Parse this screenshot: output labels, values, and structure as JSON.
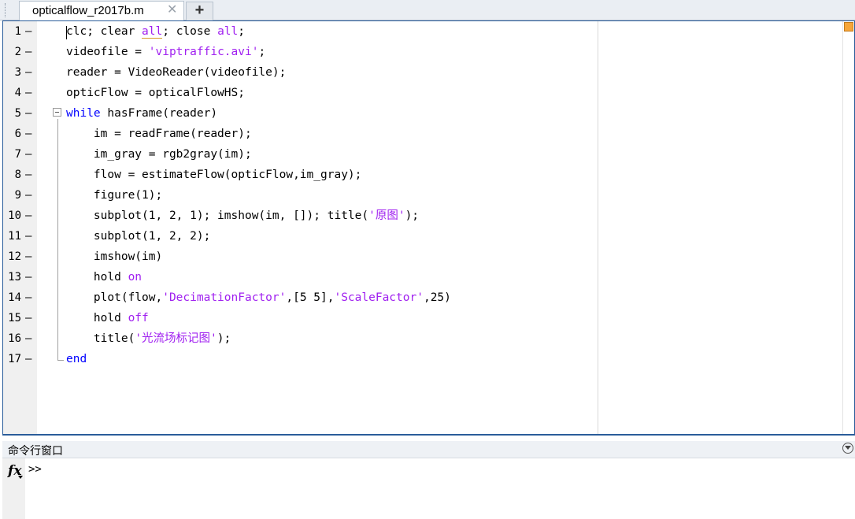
{
  "tabs": {
    "active_file": "opticalflow_r2017b.m",
    "close_glyph": "✕",
    "add_glyph": "+"
  },
  "editor": {
    "lines": [
      {
        "num": "1",
        "tokens": [
          {
            "t": "clc; clear "
          },
          {
            "t": "all",
            "c": "str",
            "u": true
          },
          {
            "t": "; close "
          },
          {
            "t": "all",
            "c": "str"
          },
          {
            "t": ";"
          }
        ]
      },
      {
        "num": "2",
        "tokens": [
          {
            "t": "videofile = "
          },
          {
            "t": "'viptraffic.avi'",
            "c": "str"
          },
          {
            "t": ";"
          }
        ]
      },
      {
        "num": "3",
        "tokens": [
          {
            "t": "reader = VideoReader(videofile);"
          }
        ]
      },
      {
        "num": "4",
        "tokens": [
          {
            "t": "opticFlow = opticalFlowHS;"
          }
        ]
      },
      {
        "num": "5",
        "tokens": [
          {
            "t": "while",
            "c": "kw"
          },
          {
            "t": " hasFrame(reader)"
          }
        ]
      },
      {
        "num": "6",
        "tokens": [
          {
            "t": "    im = readFrame(reader);"
          }
        ]
      },
      {
        "num": "7",
        "tokens": [
          {
            "t": "    im_gray = rgb2gray(im);"
          }
        ]
      },
      {
        "num": "8",
        "tokens": [
          {
            "t": "    flow = estimateFlow(opticFlow,im_gray);"
          }
        ]
      },
      {
        "num": "9",
        "tokens": [
          {
            "t": "    figure(1);"
          }
        ]
      },
      {
        "num": "10",
        "tokens": [
          {
            "t": "    subplot(1, 2, 1); imshow(im, []); title("
          },
          {
            "t": "'原图'",
            "c": "str"
          },
          {
            "t": ");"
          }
        ]
      },
      {
        "num": "11",
        "tokens": [
          {
            "t": "    subplot(1, 2, 2);"
          }
        ]
      },
      {
        "num": "12",
        "tokens": [
          {
            "t": "    imshow(im)"
          }
        ]
      },
      {
        "num": "13",
        "tokens": [
          {
            "t": "    hold "
          },
          {
            "t": "on",
            "c": "str"
          }
        ]
      },
      {
        "num": "14",
        "tokens": [
          {
            "t": "    plot(flow,"
          },
          {
            "t": "'DecimationFactor'",
            "c": "str"
          },
          {
            "t": ",[5 5],"
          },
          {
            "t": "'ScaleFactor'",
            "c": "str"
          },
          {
            "t": ",25)"
          }
        ]
      },
      {
        "num": "15",
        "tokens": [
          {
            "t": "    hold "
          },
          {
            "t": "off",
            "c": "str"
          }
        ]
      },
      {
        "num": "16",
        "tokens": [
          {
            "t": "    title("
          },
          {
            "t": "'光流场标记图'",
            "c": "str"
          },
          {
            "t": ");"
          }
        ]
      },
      {
        "num": "17",
        "tokens": [
          {
            "t": "end",
            "c": "kw"
          }
        ]
      }
    ],
    "line_marker": "—",
    "colors": {
      "keyword": "#0000ff",
      "string": "#a020f0"
    }
  },
  "command_window": {
    "title": "命令行窗口",
    "fx_label": "fx",
    "prompt": ">>"
  }
}
